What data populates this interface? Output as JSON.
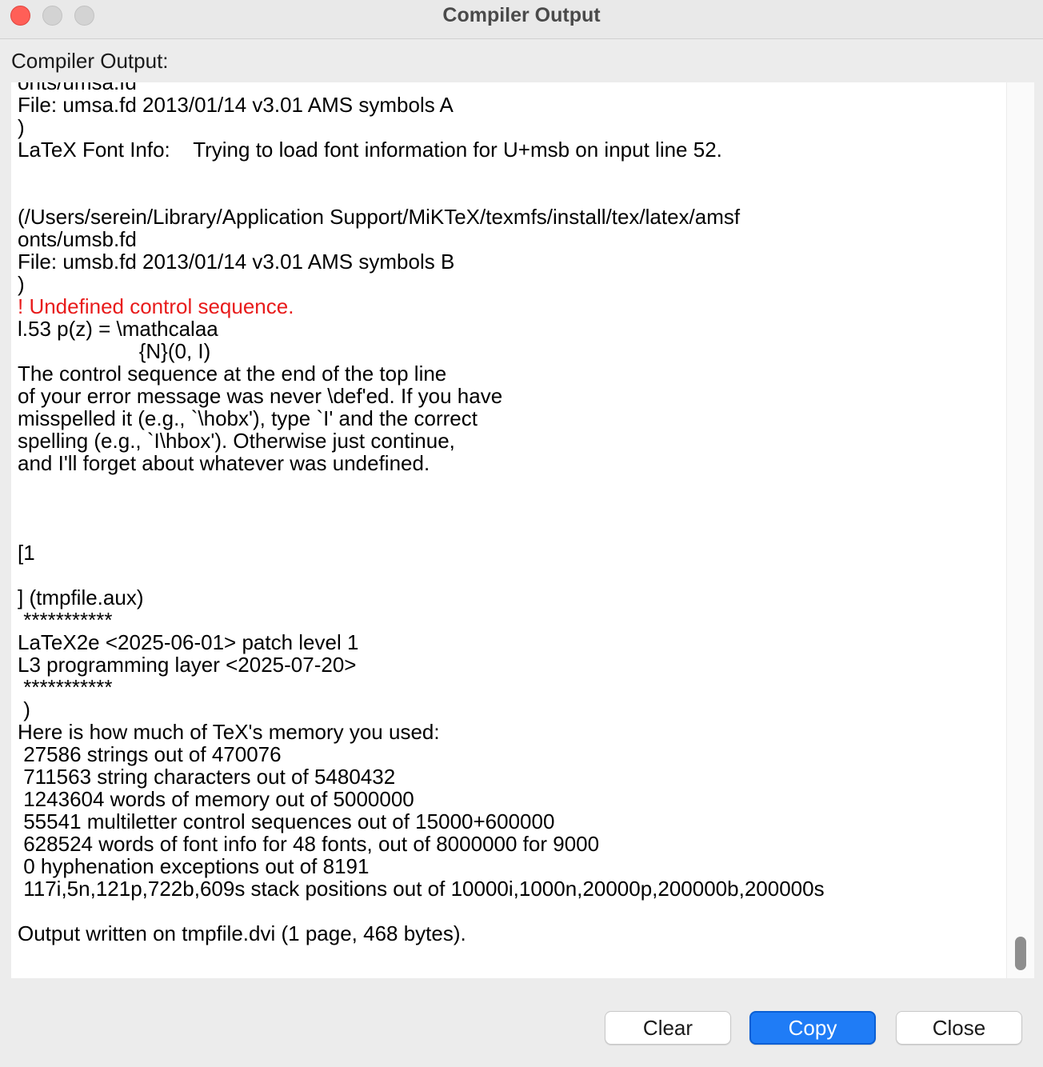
{
  "window": {
    "title": "Compiler Output"
  },
  "section_label": "Compiler Output:",
  "output": {
    "lines": [
      {
        "text": "onts/umsa.fd",
        "type": "normal"
      },
      {
        "text": "File: umsa.fd 2013/01/14 v3.01 AMS symbols A",
        "type": "normal"
      },
      {
        "text": ")",
        "type": "normal"
      },
      {
        "text": "LaTeX Font Info:    Trying to load font information for U+msb on input line 52.",
        "type": "normal"
      },
      {
        "text": "",
        "type": "normal"
      },
      {
        "text": "",
        "type": "normal"
      },
      {
        "text": "(/Users/serein/Library/Application Support/MiKTeX/texmfs/install/tex/latex/amsf",
        "type": "normal"
      },
      {
        "text": "onts/umsb.fd",
        "type": "normal"
      },
      {
        "text": "File: umsb.fd 2013/01/14 v3.01 AMS symbols B",
        "type": "normal"
      },
      {
        "text": ")",
        "type": "normal"
      },
      {
        "text": "! Undefined control sequence.",
        "type": "error"
      },
      {
        "text": "l.53 p(z) = \\mathcalaa",
        "type": "normal"
      },
      {
        "text": "                     {N}(0, I)",
        "type": "normal"
      },
      {
        "text": "The control sequence at the end of the top line",
        "type": "normal"
      },
      {
        "text": "of your error message was never \\def'ed. If you have",
        "type": "normal"
      },
      {
        "text": "misspelled it (e.g., `\\hobx'), type `I' and the correct",
        "type": "normal"
      },
      {
        "text": "spelling (e.g., `I\\hbox'). Otherwise just continue,",
        "type": "normal"
      },
      {
        "text": "and I'll forget about whatever was undefined.",
        "type": "normal"
      },
      {
        "text": "",
        "type": "normal"
      },
      {
        "text": "",
        "type": "normal"
      },
      {
        "text": "",
        "type": "normal"
      },
      {
        "text": "[1",
        "type": "normal"
      },
      {
        "text": "",
        "type": "normal"
      },
      {
        "text": "] (tmpfile.aux)",
        "type": "normal"
      },
      {
        "text": " ***********",
        "type": "normal"
      },
      {
        "text": "LaTeX2e <2025-06-01> patch level 1",
        "type": "normal"
      },
      {
        "text": "L3 programming layer <2025-07-20>",
        "type": "normal"
      },
      {
        "text": " ***********",
        "type": "normal"
      },
      {
        "text": " )",
        "type": "normal"
      },
      {
        "text": "Here is how much of TeX's memory you used:",
        "type": "normal"
      },
      {
        "text": " 27586 strings out of 470076",
        "type": "normal"
      },
      {
        "text": " 711563 string characters out of 5480432",
        "type": "normal"
      },
      {
        "text": " 1243604 words of memory out of 5000000",
        "type": "normal"
      },
      {
        "text": " 55541 multiletter control sequences out of 15000+600000",
        "type": "normal"
      },
      {
        "text": " 628524 words of font info for 48 fonts, out of 8000000 for 9000",
        "type": "normal"
      },
      {
        "text": " 0 hyphenation exceptions out of 8191",
        "type": "normal"
      },
      {
        "text": " 117i,5n,121p,722b,609s stack positions out of 10000i,1000n,20000p,200000b,200000s",
        "type": "normal"
      },
      {
        "text": "",
        "type": "normal"
      },
      {
        "text": "Output written on tmpfile.dvi (1 page, 468 bytes).",
        "type": "normal"
      }
    ],
    "scroll_position": 1.0
  },
  "buttons": {
    "clear": "Clear",
    "copy": "Copy",
    "close": "Close"
  },
  "colors": {
    "error_text": "#e81b1b",
    "primary_button": "#1f7cf6",
    "close_light": "#ff5f57"
  }
}
